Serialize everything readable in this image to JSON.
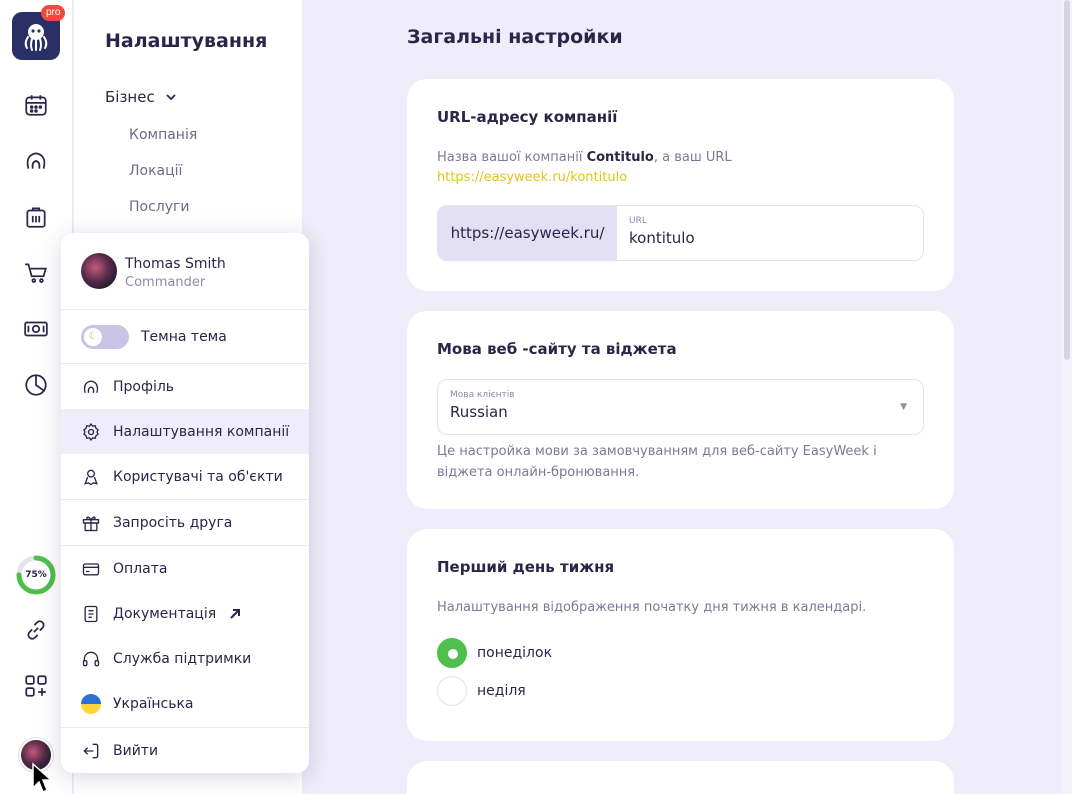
{
  "rail": {
    "pro_badge": "pro",
    "progress_label": "75%",
    "progress_percent": 75,
    "icons": [
      "calendar-icon",
      "clients-icon",
      "services-box-icon",
      "cart-icon",
      "money-icon",
      "reports-pie-icon",
      "link-icon",
      "apps-add-icon"
    ]
  },
  "settings_panel": {
    "title": "Налаштування",
    "group": "Бізнес",
    "items": [
      "Компанія",
      "Локації",
      "Послуги"
    ]
  },
  "user_menu": {
    "name": "Thomas Smith",
    "role": "Commander",
    "dark_theme_label": "Темна тема",
    "items": [
      {
        "label": "Профіль",
        "icon": "profile-icon"
      },
      {
        "label": "Налаштування компанії",
        "icon": "gear-icon"
      },
      {
        "label": "Користувачі та об'єкти",
        "icon": "users-icon"
      },
      {
        "label": "Запросіть друга",
        "icon": "gift-icon"
      },
      {
        "label": "Оплата",
        "icon": "card-icon"
      },
      {
        "label": "Документація",
        "icon": "document-icon"
      },
      {
        "label": "Служба підтримки",
        "icon": "headset-icon"
      },
      {
        "label": "Українська",
        "icon": "ukraine-flag-icon"
      },
      {
        "label": "Вийти",
        "icon": "logout-icon"
      }
    ]
  },
  "main": {
    "title": "Загальні настройки",
    "url_card": {
      "title": "URL-адресу компанії",
      "desc_prefix": "Назва вашої компанії ",
      "company": "Contitulo",
      "desc_suffix": ", а ваш URL",
      "link": "https://easyweek.ru/kontitulo",
      "prefix": "https://easyweek.ru/",
      "field_label": "URL",
      "field_value": "kontitulo"
    },
    "lang_card": {
      "title": "Мова веб -сайту та віджета",
      "field_label": "Мова клієнтів",
      "field_value": "Russian",
      "desc": "Це настройка мови за замовчуванням для веб-сайту EasyWeek і віджета онлайн-бронювання."
    },
    "week_card": {
      "title": "Перший день тижня",
      "desc": "Налаштування відображення початку дня тижня в календарі.",
      "options": [
        "понеділок",
        "неділя"
      ],
      "selected": "понеділок"
    }
  },
  "colors": {
    "accent_green": "#4fbf4c",
    "link_yellow": "#e7c21b",
    "background": "#efedf9",
    "brand_dark": "#2a2f66",
    "pro_red": "#f0493d"
  }
}
